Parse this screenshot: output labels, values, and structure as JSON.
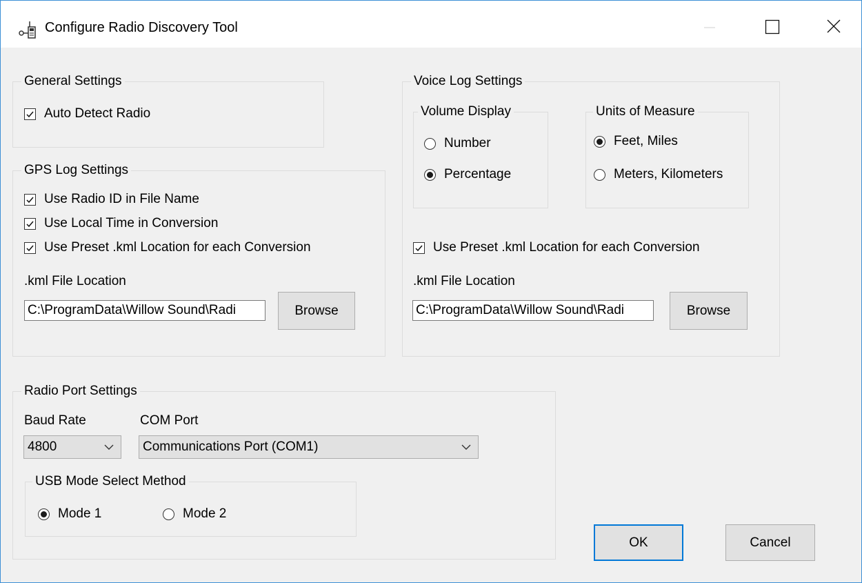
{
  "window": {
    "title": "Configure Radio Discovery Tool",
    "icon": "radio-app-icon",
    "accent_color": "#0078d7"
  },
  "general": {
    "legend": "General Settings",
    "auto_detect_label": "Auto Detect Radio",
    "auto_detect_checked": true
  },
  "gps": {
    "legend": "GPS Log Settings",
    "use_radio_id_label": "Use Radio ID in File Name",
    "use_local_time_label": "Use Local Time in Conversion",
    "use_preset_kml_label": "Use Preset .kml Location for each Conversion",
    "kml_location_label": ".kml File Location",
    "kml_path": "C:\\ProgramData\\Willow Sound\\Radi",
    "browse_label": "Browse"
  },
  "voice": {
    "legend": "Voice Log Settings",
    "volume_display": {
      "legend": "Volume Display",
      "options": [
        "Number",
        "Percentage"
      ],
      "selected": "Percentage"
    },
    "units": {
      "legend": "Units of Measure",
      "options": [
        "Feet, Miles",
        "Meters, Kilometers"
      ],
      "selected": "Feet, Miles"
    },
    "use_preset_kml_label": "Use Preset .kml Location for each Conversion",
    "kml_location_label": ".kml File Location",
    "kml_path": "C:\\ProgramData\\Willow Sound\\Radi",
    "browse_label": "Browse"
  },
  "port": {
    "legend": "Radio Port Settings",
    "baud_label": "Baud Rate",
    "baud_value": "4800",
    "com_label": "COM Port",
    "com_value": "Communications Port (COM1)",
    "usb": {
      "legend": "USB Mode Select Method",
      "options": [
        "Mode 1",
        "Mode 2"
      ],
      "selected": "Mode 1"
    }
  },
  "actions": {
    "ok_label": "OK",
    "cancel_label": "Cancel"
  }
}
